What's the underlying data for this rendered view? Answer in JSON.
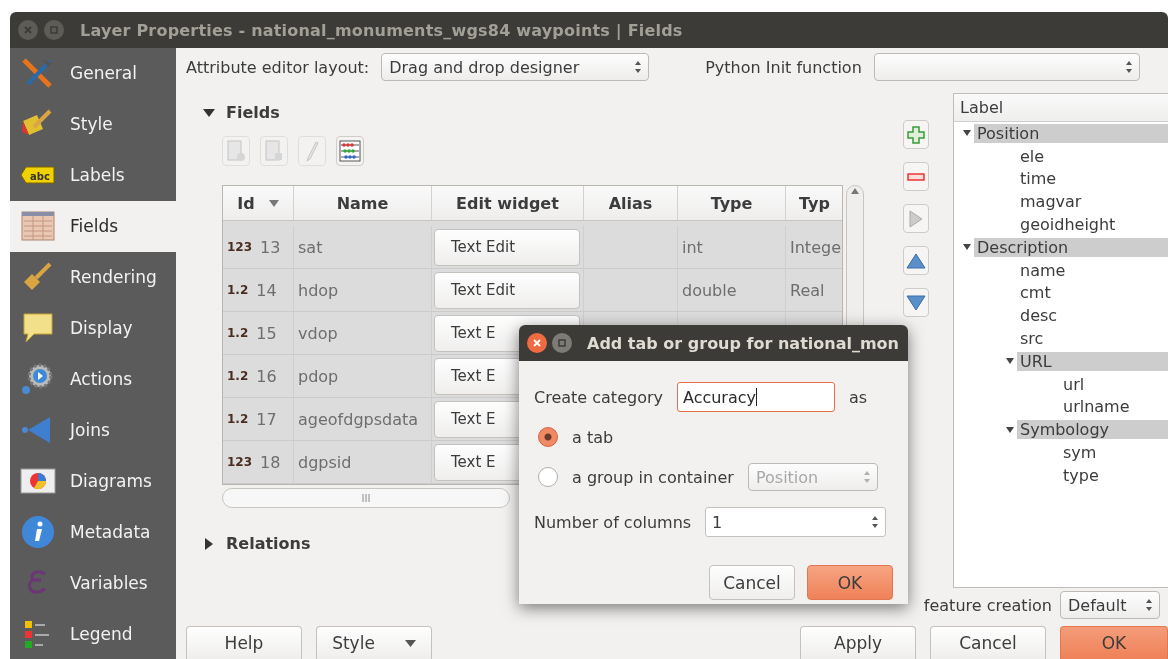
{
  "window": {
    "title": "Layer Properties - national_monuments_wgs84 waypoints | Fields"
  },
  "sidebar": {
    "items": [
      {
        "label": "General",
        "selected": false
      },
      {
        "label": "Style",
        "selected": false
      },
      {
        "label": "Labels",
        "badge": "abc",
        "selected": false
      },
      {
        "label": "Fields",
        "selected": true
      },
      {
        "label": "Rendering",
        "selected": false
      },
      {
        "label": "Display",
        "selected": false
      },
      {
        "label": "Actions",
        "selected": false
      },
      {
        "label": "Joins",
        "selected": false
      },
      {
        "label": "Diagrams",
        "selected": false
      },
      {
        "label": "Metadata",
        "selected": false
      },
      {
        "label": "Variables",
        "selected": false
      },
      {
        "label": "Legend",
        "selected": false
      }
    ]
  },
  "editor_layout": {
    "label": "Attribute editor layout:",
    "value": "Drag and drop designer"
  },
  "python_init": {
    "label": "Python Init function"
  },
  "fields_section": {
    "title": "Fields",
    "expanded": true
  },
  "toolbar": [
    {
      "disabled": true
    },
    {
      "disabled": true
    },
    {
      "disabled": true
    },
    {
      "disabled": false
    }
  ],
  "table": {
    "columns": [
      "Id",
      "Name",
      "Edit widget",
      "Alias",
      "Type",
      "Typ"
    ],
    "rows": [
      {
        "type_badge": "123",
        "id": "13",
        "name": "sat",
        "widget": "Text Edit",
        "type": "int",
        "type_name": "Intege"
      },
      {
        "type_badge": "1.2",
        "id": "14",
        "name": "hdop",
        "widget": "Text Edit",
        "type": "double",
        "type_name": "Real"
      },
      {
        "type_badge": "1.2",
        "id": "15",
        "name": "vdop",
        "widget": "Text E"
      },
      {
        "type_badge": "1.2",
        "id": "16",
        "name": "pdop",
        "widget": "Text E"
      },
      {
        "type_badge": "1.2",
        "id": "17",
        "name": "ageofdgpsdata",
        "widget": "Text E"
      },
      {
        "type_badge": "123",
        "id": "18",
        "name": "dgpsid",
        "widget": "Text E"
      }
    ]
  },
  "relations_section": {
    "title": "Relations",
    "expanded": false
  },
  "tree": {
    "header": "Label",
    "items": [
      {
        "label": "Position",
        "kind": "container",
        "expanded": true,
        "children": [
          {
            "label": "ele",
            "kind": "field"
          },
          {
            "label": "time",
            "kind": "field"
          },
          {
            "label": "magvar",
            "kind": "field"
          },
          {
            "label": "geoidheight",
            "kind": "field"
          }
        ]
      },
      {
        "label": "Description",
        "kind": "container",
        "expanded": true,
        "children": [
          {
            "label": "name",
            "kind": "field"
          },
          {
            "label": "cmt",
            "kind": "field"
          },
          {
            "label": "desc",
            "kind": "field"
          },
          {
            "label": "src",
            "kind": "field"
          },
          {
            "label": "URL",
            "kind": "container",
            "expanded": true,
            "children": [
              {
                "label": "url",
                "kind": "field"
              },
              {
                "label": "urlname",
                "kind": "field"
              }
            ]
          },
          {
            "label": "Symbology",
            "kind": "container",
            "expanded": true,
            "children": [
              {
                "label": "sym",
                "kind": "field"
              },
              {
                "label": "type",
                "kind": "field"
              }
            ]
          }
        ]
      }
    ]
  },
  "suppress": {
    "label": "feature creation",
    "value": "Default"
  },
  "buttons": [
    {
      "label": "Help",
      "kind": "plain",
      "default": false
    },
    {
      "label": "Style",
      "kind": "dropdown",
      "default": false
    },
    {
      "label": "Apply",
      "kind": "plain",
      "default": false
    },
    {
      "label": "Cancel",
      "kind": "plain",
      "default": false
    },
    {
      "label": "OK",
      "kind": "plain",
      "default": true
    }
  ],
  "dialog": {
    "title": "Add tab or group for national_mon",
    "category_label": "Create category",
    "category_value": "Accuracy",
    "as_label": "as",
    "options": [
      {
        "label": "a tab",
        "selected": true
      },
      {
        "label": "a group in container",
        "selected": false
      }
    ],
    "container": {
      "value": "Position",
      "disabled": true
    },
    "columns_label": "Number of columns",
    "columns_value": "1",
    "buttons": [
      {
        "label": "Cancel",
        "default": false
      },
      {
        "label": "OK",
        "default": true
      }
    ]
  }
}
